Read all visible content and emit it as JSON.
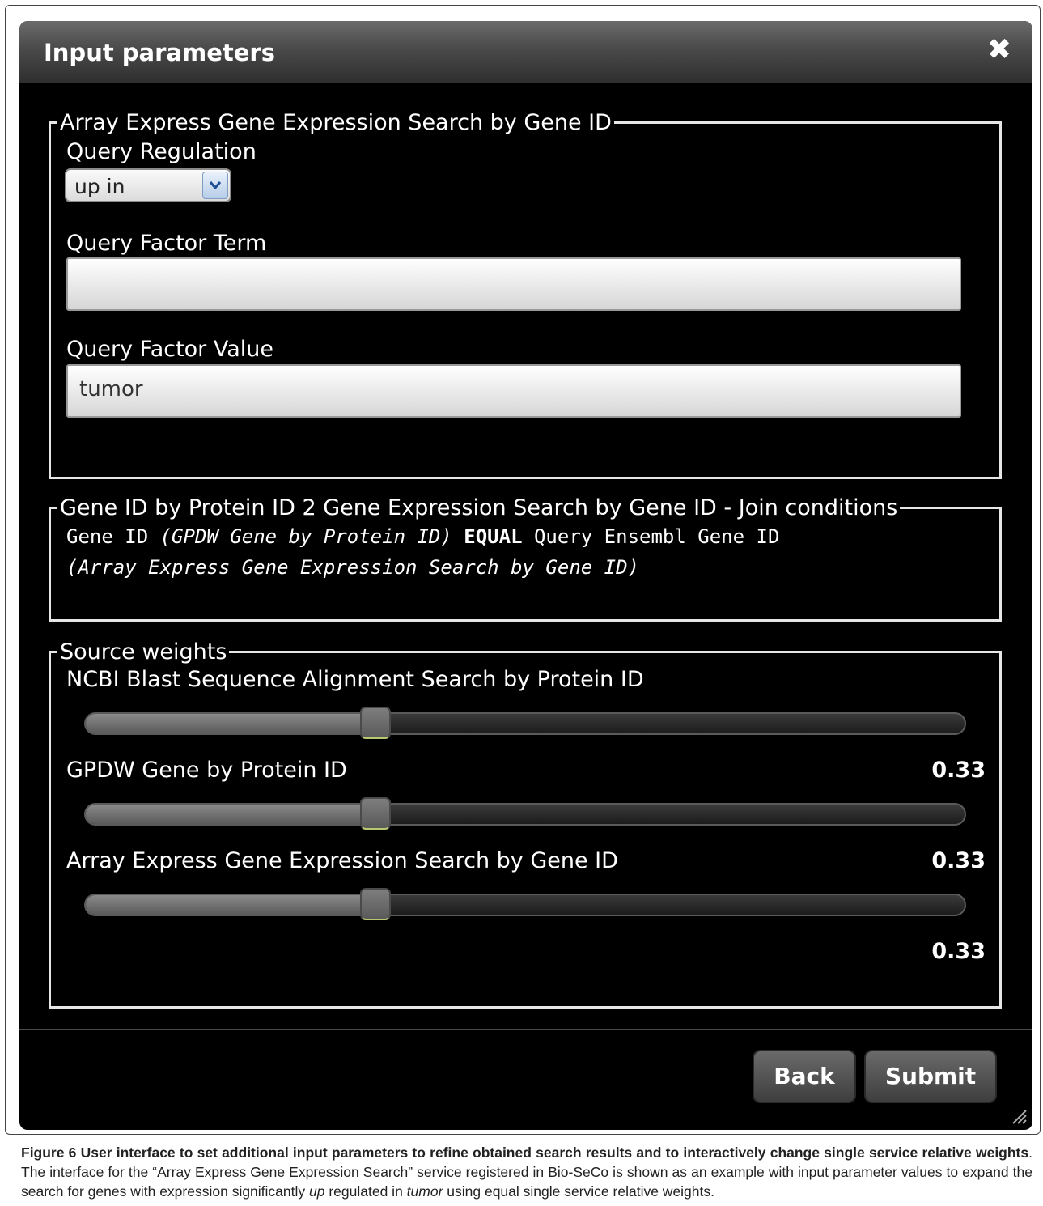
{
  "dialog": {
    "title": "Input parameters",
    "close_symbol": "✖"
  },
  "group_params": {
    "legend": "Array Express Gene Expression Search by Gene ID",
    "query_regulation_label": "Query Regulation",
    "query_regulation_value": "up in",
    "query_factor_term_label": "Query Factor Term",
    "query_factor_term_value": "",
    "query_factor_value_label": "Query Factor Value",
    "query_factor_value_value": "tumor"
  },
  "group_join": {
    "legend": "Gene ID by Protein ID 2 Gene Expression Search by Gene ID - Join conditions",
    "part1": "Gene ID ",
    "part2": "(GPDW Gene by Protein ID)",
    "part3": " EQUAL",
    "part4": " Query Ensembl Gene ID",
    "part5": "(Array Express Gene Expression Search by Gene ID)"
  },
  "group_weights": {
    "legend": "Source weights",
    "items": [
      {
        "label": "NCBI Blast Sequence Alignment Search by Protein ID",
        "value": "0.33",
        "fraction": 0.33
      },
      {
        "label": "GPDW Gene by Protein ID",
        "value": "0.33",
        "fraction": 0.33
      },
      {
        "label": "Array Express Gene Expression Search by Gene ID",
        "value": "0.33",
        "fraction": 0.33
      }
    ]
  },
  "buttons": {
    "back": "Back",
    "submit": "Submit"
  },
  "caption": {
    "lead": "Figure 6 User interface to set additional input parameters to refine obtained search results and to interactively change single service relative weights",
    "p1": ". The interface for the “Array Express Gene Expression Search” service registered in Bio-SeCo is shown as an example with input parameter values to expand the search for genes with expression significantly ",
    "em1": "up",
    "p2": " regulated in ",
    "em2": "tumor",
    "p3": " using equal single service relative weights."
  },
  "icons": {
    "close": "close-icon",
    "dropdown": "chevron-down-icon",
    "resize": "resize-grip-icon"
  }
}
